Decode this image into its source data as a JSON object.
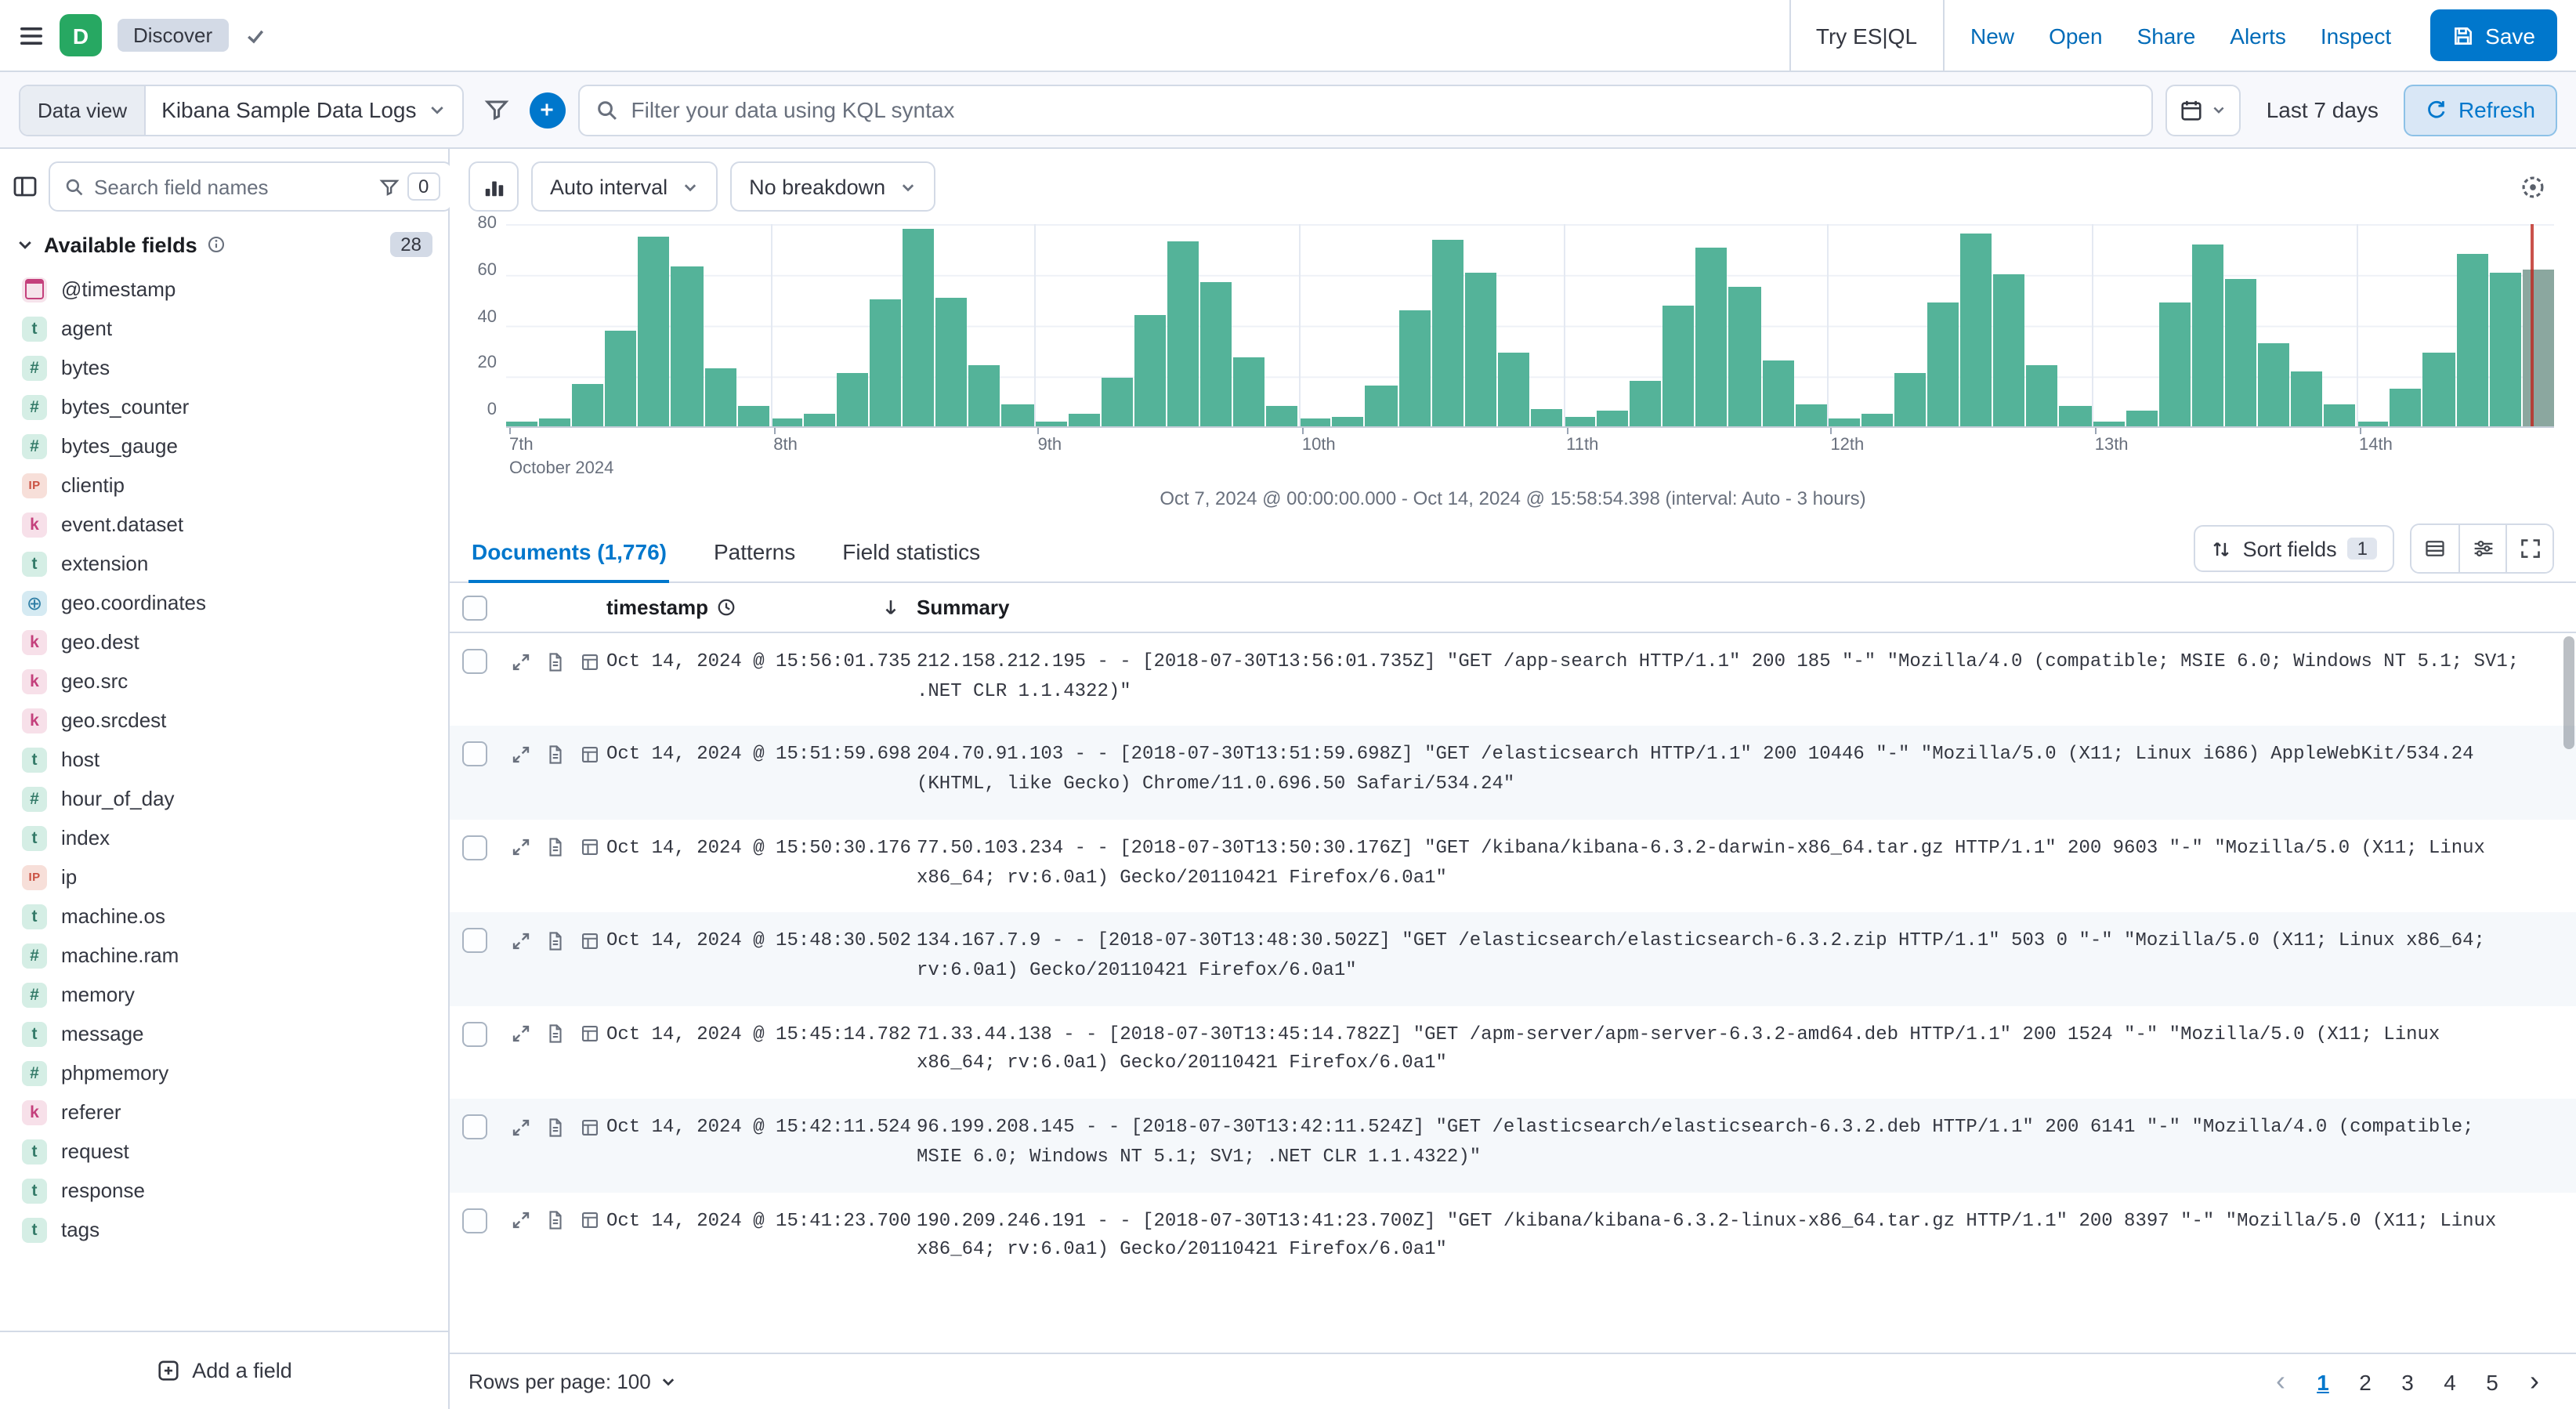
{
  "colors": {
    "accent": "#0077CC",
    "link": "#006BB8",
    "bar": "#54B399",
    "partial_bar": "#8BA79F",
    "marker": "#BD271E",
    "space_avatar": "#27A862"
  },
  "icons": {
    "text_glyph": "t",
    "keyword_glyph": "k",
    "number_glyph": "#",
    "ip_glyph": "IP",
    "geo_glyph": "⊕",
    "prev_glyph": "‹",
    "next_glyph": "›"
  },
  "header": {
    "space_initial": "D",
    "breadcrumb": "Discover",
    "try_esql": "Try ES|QL",
    "nav_links": [
      "New",
      "Open",
      "Share",
      "Alerts",
      "Inspect"
    ],
    "save_label": "Save"
  },
  "query_bar": {
    "data_view_label": "Data view",
    "data_view_value": "Kibana Sample Data Logs",
    "search_placeholder": "Filter your data using KQL syntax",
    "time_range": "Last 7 days",
    "refresh_label": "Refresh"
  },
  "sidebar": {
    "search_placeholder": "Search field names",
    "filter_count": "0",
    "section_title": "Available fields",
    "field_count": "28",
    "add_field_label": "Add a field",
    "fields": [
      {
        "name": "@timestamp",
        "type": "date"
      },
      {
        "name": "agent",
        "type": "text"
      },
      {
        "name": "bytes",
        "type": "number"
      },
      {
        "name": "bytes_counter",
        "type": "number"
      },
      {
        "name": "bytes_gauge",
        "type": "number"
      },
      {
        "name": "clientip",
        "type": "ip"
      },
      {
        "name": "event.dataset",
        "type": "keyword"
      },
      {
        "name": "extension",
        "type": "text"
      },
      {
        "name": "geo.coordinates",
        "type": "geo"
      },
      {
        "name": "geo.dest",
        "type": "keyword"
      },
      {
        "name": "geo.src",
        "type": "keyword"
      },
      {
        "name": "geo.srcdest",
        "type": "keyword"
      },
      {
        "name": "host",
        "type": "text"
      },
      {
        "name": "hour_of_day",
        "type": "number"
      },
      {
        "name": "index",
        "type": "text"
      },
      {
        "name": "ip",
        "type": "ip"
      },
      {
        "name": "machine.os",
        "type": "text"
      },
      {
        "name": "machine.ram",
        "type": "number"
      },
      {
        "name": "memory",
        "type": "number"
      },
      {
        "name": "message",
        "type": "text"
      },
      {
        "name": "phpmemory",
        "type": "number"
      },
      {
        "name": "referer",
        "type": "keyword"
      },
      {
        "name": "request",
        "type": "text"
      },
      {
        "name": "response",
        "type": "text"
      },
      {
        "name": "tags",
        "type": "text"
      }
    ]
  },
  "histogram": {
    "interval_label": "Auto interval",
    "breakdown_label": "No breakdown",
    "caption": "Oct 7, 2024 @ 00:00:00.000 - Oct 14, 2024 @ 15:58:54.398 (interval: Auto - 3 hours)"
  },
  "chart_data": {
    "type": "bar",
    "title": "",
    "xlabel": "",
    "ylabel": "",
    "ylim": [
      0,
      80
    ],
    "y_ticks": [
      0,
      20,
      40,
      60,
      80
    ],
    "x_day_labels": [
      "7th",
      "8th",
      "9th",
      "10th",
      "11th",
      "12th",
      "13th",
      "14th"
    ],
    "x_sub_label": "October 2024",
    "bars_per_day": 8,
    "interval": "3 hours",
    "grid": true,
    "legend": false,
    "values": [
      2,
      3,
      17,
      38,
      75,
      63,
      23,
      8,
      3,
      5,
      21,
      50,
      78,
      51,
      24,
      9,
      2,
      5,
      19,
      44,
      73,
      57,
      27,
      8,
      3,
      4,
      16,
      46,
      74,
      61,
      29,
      7,
      4,
      6,
      18,
      48,
      71,
      55,
      26,
      9,
      3,
      5,
      21,
      49,
      76,
      60,
      24,
      8,
      2,
      6,
      49,
      72,
      58,
      33,
      22,
      9,
      2,
      15,
      29,
      68,
      61,
      62
    ]
  },
  "tabs": [
    {
      "label": "Documents (1,776)",
      "active": true
    },
    {
      "label": "Patterns",
      "active": false
    },
    {
      "label": "Field statistics",
      "active": false
    }
  ],
  "table_controls": {
    "sort_fields_label": "Sort fields",
    "sort_count": "1"
  },
  "table": {
    "header": {
      "timestamp": "timestamp",
      "summary": "Summary"
    },
    "rows": [
      {
        "timestamp": "Oct 14, 2024 @ 15:56:01.735",
        "summary": "212.158.212.195 - - [2018-07-30T13:56:01.735Z] \"GET /app-search HTTP/1.1\" 200 185 \"-\" \"Mozilla/4.0 (compatible; MSIE 6.0; Windows NT 5.1; SV1; .NET CLR 1.1.4322)\""
      },
      {
        "timestamp": "Oct 14, 2024 @ 15:51:59.698",
        "summary": "204.70.91.103 - - [2018-07-30T13:51:59.698Z] \"GET /elasticsearch HTTP/1.1\" 200 10446 \"-\" \"Mozilla/5.0 (X11; Linux i686) AppleWebKit/534.24 (KHTML, like Gecko) Chrome/11.0.696.50 Safari/534.24\""
      },
      {
        "timestamp": "Oct 14, 2024 @ 15:50:30.176",
        "summary": "77.50.103.234 - - [2018-07-30T13:50:30.176Z] \"GET /kibana/kibana-6.3.2-darwin-x86_64.tar.gz HTTP/1.1\" 200 9603 \"-\" \"Mozilla/5.0 (X11; Linux x86_64; rv:6.0a1) Gecko/20110421 Firefox/6.0a1\""
      },
      {
        "timestamp": "Oct 14, 2024 @ 15:48:30.502",
        "summary": "134.167.7.9 - - [2018-07-30T13:48:30.502Z] \"GET /elasticsearch/elasticsearch-6.3.2.zip HTTP/1.1\" 503 0 \"-\" \"Mozilla/5.0 (X11; Linux x86_64; rv:6.0a1) Gecko/20110421 Firefox/6.0a1\""
      },
      {
        "timestamp": "Oct 14, 2024 @ 15:45:14.782",
        "summary": "71.33.44.138 - - [2018-07-30T13:45:14.782Z] \"GET /apm-server/apm-server-6.3.2-amd64.deb HTTP/1.1\" 200 1524 \"-\" \"Mozilla/5.0 (X11; Linux x86_64; rv:6.0a1) Gecko/20110421 Firefox/6.0a1\""
      },
      {
        "timestamp": "Oct 14, 2024 @ 15:42:11.524",
        "summary": "96.199.208.145 - - [2018-07-30T13:42:11.524Z] \"GET /elasticsearch/elasticsearch-6.3.2.deb HTTP/1.1\" 200 6141 \"-\" \"Mozilla/4.0 (compatible; MSIE 6.0; Windows NT 5.1; SV1; .NET CLR 1.1.4322)\""
      },
      {
        "timestamp": "Oct 14, 2024 @ 15:41:23.700",
        "summary": "190.209.246.191 - - [2018-07-30T13:41:23.700Z] \"GET /kibana/kibana-6.3.2-linux-x86_64.tar.gz HTTP/1.1\" 200 8397 \"-\" \"Mozilla/5.0 (X11; Linux x86_64; rv:6.0a1) Gecko/20110421 Firefox/6.0a1\""
      }
    ]
  },
  "footer": {
    "rows_per_page_label": "Rows per page: 100",
    "pagination": {
      "pages": [
        "1",
        "2",
        "3",
        "4",
        "5"
      ],
      "active_index": 0
    }
  }
}
